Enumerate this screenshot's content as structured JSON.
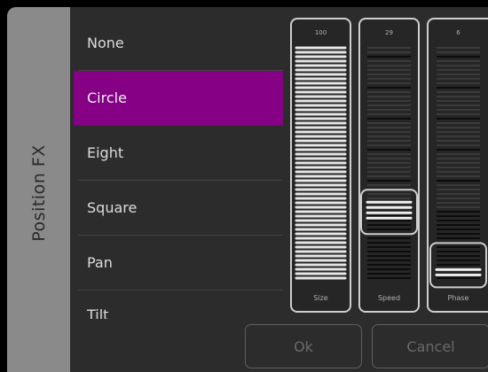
{
  "panel": {
    "title": "Position FX"
  },
  "effects": {
    "items": [
      {
        "label": "None"
      },
      {
        "label": "Circle",
        "selected": true
      },
      {
        "label": "Eight"
      },
      {
        "label": "Square"
      },
      {
        "label": "Pan"
      },
      {
        "label": "Tilt"
      }
    ]
  },
  "faders": [
    {
      "value": "100",
      "label": "Size",
      "level": 100
    },
    {
      "value": "29",
      "label": "Speed",
      "level": 29
    },
    {
      "value": "6",
      "label": "Phase",
      "level": 6
    }
  ],
  "buttons": {
    "ok": "Ok",
    "cancel": "Cancel"
  },
  "colors": {
    "selected": "#850085",
    "background": "#2c2c2c",
    "side_tab": "#8a8a8a",
    "fader_border": "#cfcfcf"
  }
}
